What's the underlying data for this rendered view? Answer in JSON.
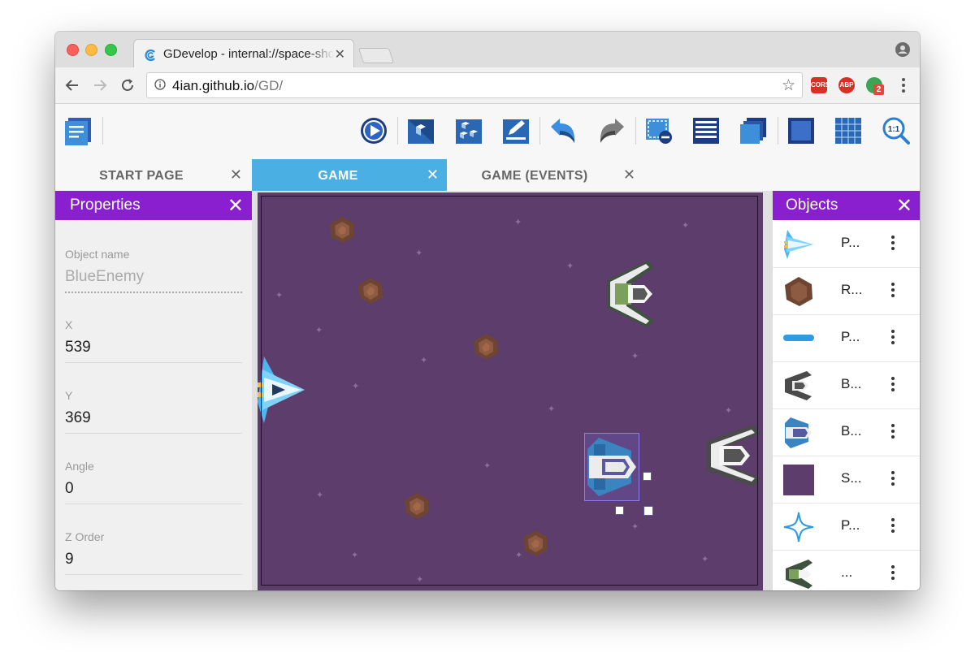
{
  "browser": {
    "tab_title": "GDevelop - internal://space-shooter",
    "address_host": "4ian.github.io",
    "address_path": "/GD/",
    "extensions": [
      {
        "name": "cors-extension-icon",
        "label": "CORS",
        "color": "#d93025"
      },
      {
        "name": "adblock-plus-icon",
        "label": "ABP",
        "color": "#d93025"
      },
      {
        "name": "extension-badge-icon",
        "label": "2",
        "color": "#e8453c"
      }
    ]
  },
  "editor_tabs": [
    {
      "label": "START PAGE"
    },
    {
      "label": "GAME"
    },
    {
      "label": "GAME (EVENTS)"
    }
  ],
  "properties": {
    "title": "Properties",
    "fields": [
      {
        "label": "Object name",
        "value": "BlueEnemy"
      },
      {
        "label": "X",
        "value": "539"
      },
      {
        "label": "Y",
        "value": "369"
      },
      {
        "label": "Angle",
        "value": "0"
      },
      {
        "label": "Z Order",
        "value": "9"
      }
    ]
  },
  "objects": {
    "title": "Objects",
    "items": [
      {
        "name": "P...",
        "icon": "player-ship-icon"
      },
      {
        "name": "R...",
        "icon": "rock-icon"
      },
      {
        "name": "P...",
        "icon": "projectile-bar-icon"
      },
      {
        "name": "B...",
        "icon": "black-enemy-icon"
      },
      {
        "name": "B...",
        "icon": "blue-enemy-icon"
      },
      {
        "name": "S...",
        "icon": "space-background-icon"
      },
      {
        "name": "P...",
        "icon": "particle-star-icon"
      },
      {
        "name": "...",
        "icon": "green-enemy-icon"
      }
    ]
  },
  "colors": {
    "panel_header": "#8a1fd0",
    "active_tab": "#4ab0e4",
    "scene_background": "#5c3d6b"
  }
}
